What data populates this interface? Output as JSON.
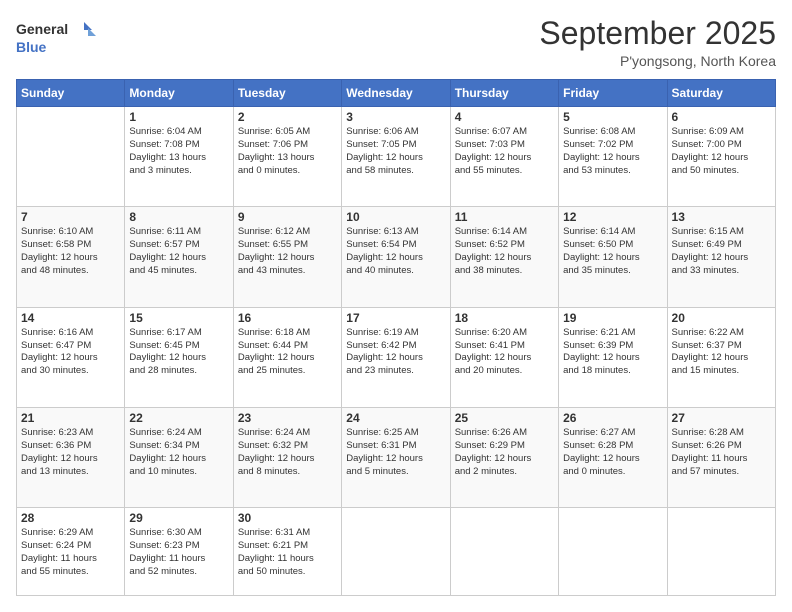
{
  "header": {
    "logo": {
      "line1": "General",
      "line2": "Blue"
    },
    "title": "September 2025",
    "subtitle": "P'yongsong, North Korea"
  },
  "weekdays": [
    "Sunday",
    "Monday",
    "Tuesday",
    "Wednesday",
    "Thursday",
    "Friday",
    "Saturday"
  ],
  "weeks": [
    [
      {
        "day": "",
        "info": ""
      },
      {
        "day": "1",
        "info": "Sunrise: 6:04 AM\nSunset: 7:08 PM\nDaylight: 13 hours\nand 3 minutes."
      },
      {
        "day": "2",
        "info": "Sunrise: 6:05 AM\nSunset: 7:06 PM\nDaylight: 13 hours\nand 0 minutes."
      },
      {
        "day": "3",
        "info": "Sunrise: 6:06 AM\nSunset: 7:05 PM\nDaylight: 12 hours\nand 58 minutes."
      },
      {
        "day": "4",
        "info": "Sunrise: 6:07 AM\nSunset: 7:03 PM\nDaylight: 12 hours\nand 55 minutes."
      },
      {
        "day": "5",
        "info": "Sunrise: 6:08 AM\nSunset: 7:02 PM\nDaylight: 12 hours\nand 53 minutes."
      },
      {
        "day": "6",
        "info": "Sunrise: 6:09 AM\nSunset: 7:00 PM\nDaylight: 12 hours\nand 50 minutes."
      }
    ],
    [
      {
        "day": "7",
        "info": "Sunrise: 6:10 AM\nSunset: 6:58 PM\nDaylight: 12 hours\nand 48 minutes."
      },
      {
        "day": "8",
        "info": "Sunrise: 6:11 AM\nSunset: 6:57 PM\nDaylight: 12 hours\nand 45 minutes."
      },
      {
        "day": "9",
        "info": "Sunrise: 6:12 AM\nSunset: 6:55 PM\nDaylight: 12 hours\nand 43 minutes."
      },
      {
        "day": "10",
        "info": "Sunrise: 6:13 AM\nSunset: 6:54 PM\nDaylight: 12 hours\nand 40 minutes."
      },
      {
        "day": "11",
        "info": "Sunrise: 6:14 AM\nSunset: 6:52 PM\nDaylight: 12 hours\nand 38 minutes."
      },
      {
        "day": "12",
        "info": "Sunrise: 6:14 AM\nSunset: 6:50 PM\nDaylight: 12 hours\nand 35 minutes."
      },
      {
        "day": "13",
        "info": "Sunrise: 6:15 AM\nSunset: 6:49 PM\nDaylight: 12 hours\nand 33 minutes."
      }
    ],
    [
      {
        "day": "14",
        "info": "Sunrise: 6:16 AM\nSunset: 6:47 PM\nDaylight: 12 hours\nand 30 minutes."
      },
      {
        "day": "15",
        "info": "Sunrise: 6:17 AM\nSunset: 6:45 PM\nDaylight: 12 hours\nand 28 minutes."
      },
      {
        "day": "16",
        "info": "Sunrise: 6:18 AM\nSunset: 6:44 PM\nDaylight: 12 hours\nand 25 minutes."
      },
      {
        "day": "17",
        "info": "Sunrise: 6:19 AM\nSunset: 6:42 PM\nDaylight: 12 hours\nand 23 minutes."
      },
      {
        "day": "18",
        "info": "Sunrise: 6:20 AM\nSunset: 6:41 PM\nDaylight: 12 hours\nand 20 minutes."
      },
      {
        "day": "19",
        "info": "Sunrise: 6:21 AM\nSunset: 6:39 PM\nDaylight: 12 hours\nand 18 minutes."
      },
      {
        "day": "20",
        "info": "Sunrise: 6:22 AM\nSunset: 6:37 PM\nDaylight: 12 hours\nand 15 minutes."
      }
    ],
    [
      {
        "day": "21",
        "info": "Sunrise: 6:23 AM\nSunset: 6:36 PM\nDaylight: 12 hours\nand 13 minutes."
      },
      {
        "day": "22",
        "info": "Sunrise: 6:24 AM\nSunset: 6:34 PM\nDaylight: 12 hours\nand 10 minutes."
      },
      {
        "day": "23",
        "info": "Sunrise: 6:24 AM\nSunset: 6:32 PM\nDaylight: 12 hours\nand 8 minutes."
      },
      {
        "day": "24",
        "info": "Sunrise: 6:25 AM\nSunset: 6:31 PM\nDaylight: 12 hours\nand 5 minutes."
      },
      {
        "day": "25",
        "info": "Sunrise: 6:26 AM\nSunset: 6:29 PM\nDaylight: 12 hours\nand 2 minutes."
      },
      {
        "day": "26",
        "info": "Sunrise: 6:27 AM\nSunset: 6:28 PM\nDaylight: 12 hours\nand 0 minutes."
      },
      {
        "day": "27",
        "info": "Sunrise: 6:28 AM\nSunset: 6:26 PM\nDaylight: 11 hours\nand 57 minutes."
      }
    ],
    [
      {
        "day": "28",
        "info": "Sunrise: 6:29 AM\nSunset: 6:24 PM\nDaylight: 11 hours\nand 55 minutes."
      },
      {
        "day": "29",
        "info": "Sunrise: 6:30 AM\nSunset: 6:23 PM\nDaylight: 11 hours\nand 52 minutes."
      },
      {
        "day": "30",
        "info": "Sunrise: 6:31 AM\nSunset: 6:21 PM\nDaylight: 11 hours\nand 50 minutes."
      },
      {
        "day": "",
        "info": ""
      },
      {
        "day": "",
        "info": ""
      },
      {
        "day": "",
        "info": ""
      },
      {
        "day": "",
        "info": ""
      }
    ]
  ]
}
